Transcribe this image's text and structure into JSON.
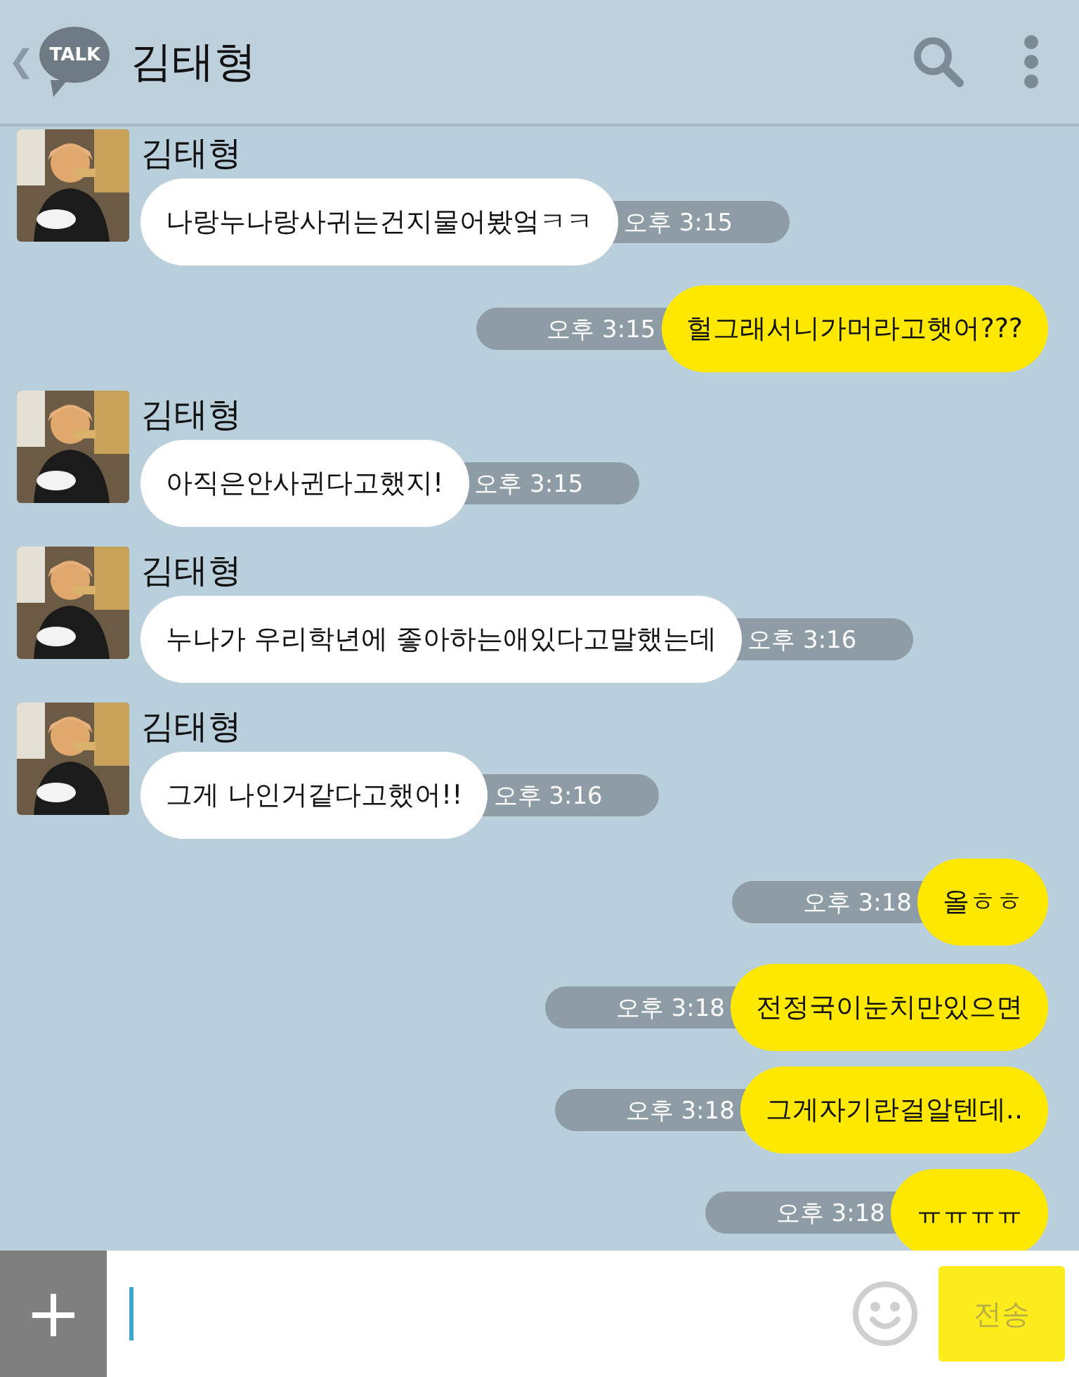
{
  "header": {
    "back": "❮",
    "logo": "TALK",
    "title": "김태형"
  },
  "messages": [
    {
      "kind": "incoming",
      "sender": "김태형",
      "text": "나랑누나랑사귀는건지물어봤엌ㅋㅋ",
      "time": "오후 3:15"
    },
    {
      "kind": "outgoing",
      "text": "헐그래서니가머라고햇어???",
      "time": "오후 3:15"
    },
    {
      "kind": "incoming",
      "sender": "김태형",
      "text": "아직은안사귄다고했지!",
      "time": "오후 3:15"
    },
    {
      "kind": "incoming",
      "sender": "김태형",
      "text": "누나가 우리학년에 좋아하는애있다고말했는데",
      "time": "오후 3:16"
    },
    {
      "kind": "incoming",
      "sender": "김태형",
      "text": "그게 나인거같다고했어!!",
      "time": "오후 3:16"
    },
    {
      "kind": "outgoing",
      "text": "올ㅎㅎ",
      "time": "오후 3:18"
    },
    {
      "kind": "outgoing",
      "text": "전정국이눈치만있으면",
      "time": "오후 3:18"
    },
    {
      "kind": "outgoing",
      "text": "그게자기란걸알텐데..",
      "time": "오후 3:18"
    },
    {
      "kind": "outgoing",
      "text": "ㅠㅠㅠㅠ",
      "time": "오후 3:18"
    }
  ],
  "composer": {
    "plus": "+",
    "send": "전송"
  }
}
